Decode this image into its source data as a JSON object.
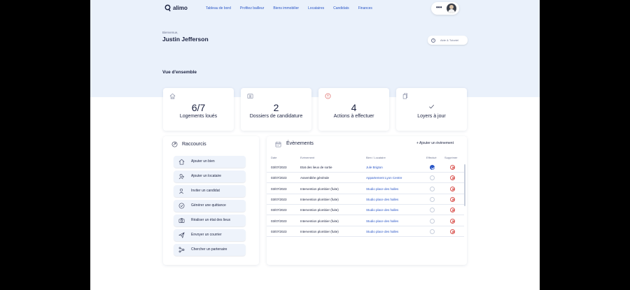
{
  "brand": {
    "name": "alimo"
  },
  "nav": {
    "links": [
      "Tableau de bord",
      "Profitez bailleur",
      "Biens immobilier",
      "Locataires",
      "Candidats",
      "Finances"
    ],
    "more_label": "•••"
  },
  "header": {
    "welcome": "Bienvenue,",
    "username": "Justin Jefferson",
    "help_label": "Aide & Tutoriel"
  },
  "overview": {
    "title": "Vue d'ensemble",
    "cards": [
      {
        "value": "6/7",
        "label": "Logements loués",
        "icon": "house-icon"
      },
      {
        "value": "2",
        "label": "Dossiers de candidature",
        "icon": "folder-icon"
      },
      {
        "value": "4",
        "label": "Actions à effectuer",
        "icon": "alert-icon"
      },
      {
        "value": "",
        "label": "Loyers à jour",
        "icon": "check-icon"
      }
    ]
  },
  "shortcuts": {
    "title": "Raccourcis",
    "items": [
      "Ajouter un bien",
      "Ajouter un locataire",
      "Inviter un candidat",
      "Générer une quittance",
      "Réaliser un état des lieux",
      "Envoyer un courrier",
      "Chercher un partenaire"
    ]
  },
  "events": {
    "title": "Évènements",
    "add_label": "+ Ajouter un évènement",
    "columns": [
      "Date",
      "Evènement",
      "Bien / Locataire",
      "Effectué",
      "Supprimer"
    ],
    "rows": [
      {
        "date": "03/07/2023",
        "event": "Etat des lieux de sortie",
        "target": "Jule Brigton",
        "done": true
      },
      {
        "date": "03/07/2023",
        "event": "Assemblée générale",
        "target": "Appartement Lyon Centre",
        "done": false
      },
      {
        "date": "03/07/2023",
        "event": "Intervention plombier (fuite)",
        "target": "Studio place des halles",
        "done": false
      },
      {
        "date": "03/07/2023",
        "event": "Intervention plombier (fuite)",
        "target": "Studio place des halles",
        "done": false
      },
      {
        "date": "03/07/2023",
        "event": "Intervention plombier (fuite)",
        "target": "Studio place des halles",
        "done": false
      },
      {
        "date": "03/07/2023",
        "event": "Intervention plombier (fuite)",
        "target": "Studio place des halles",
        "done": false
      },
      {
        "date": "03/07/2023",
        "event": "Intervention plombier (fuite)",
        "target": "Studio place des halles",
        "done": false
      }
    ]
  },
  "colors": {
    "primary": "#2a56c6",
    "hero_bg": "#eaf1fb",
    "danger": "#d9534f",
    "text": "#1b2240"
  }
}
